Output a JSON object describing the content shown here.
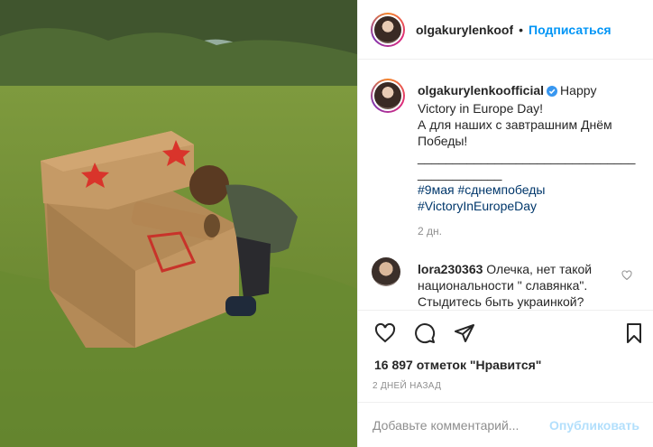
{
  "photo": {
    "description_icon": "cardboard-tank-photo"
  },
  "header": {
    "username": "olgakurylenkoof",
    "dot": "•",
    "follow_label": "Подписаться"
  },
  "caption": {
    "username": "olgakurylenkoofficial",
    "line1": "Happy",
    "line2": "Victory in Europe Day!",
    "line3": "А для наших с завтрашним Днём",
    "line4": "Победы!",
    "separator": "___________________________________________",
    "hashtags1": "#9мая #сднемпобеды",
    "hashtags2": "#VictoryInEuropeDay",
    "time": "2 дн."
  },
  "comment": {
    "username": "lora230363",
    "text": "Олечка, нет такой национальности \" славянка\". Стыдитесь быть украинкой?"
  },
  "actions": {
    "like_icon": "heart-icon",
    "comment_icon": "comment-icon",
    "share_icon": "share-icon",
    "save_icon": "bookmark-icon"
  },
  "likes": {
    "text": "16 897 отметок \"Нравится\""
  },
  "date": {
    "text": "2 дней назад"
  },
  "add_comment": {
    "placeholder": "Добавьте комментарий...",
    "publish_label": "Опубликовать"
  },
  "colors": {
    "accent": "#0095f6",
    "verified": "#3897f0",
    "muted": "#8e8e8e"
  }
}
